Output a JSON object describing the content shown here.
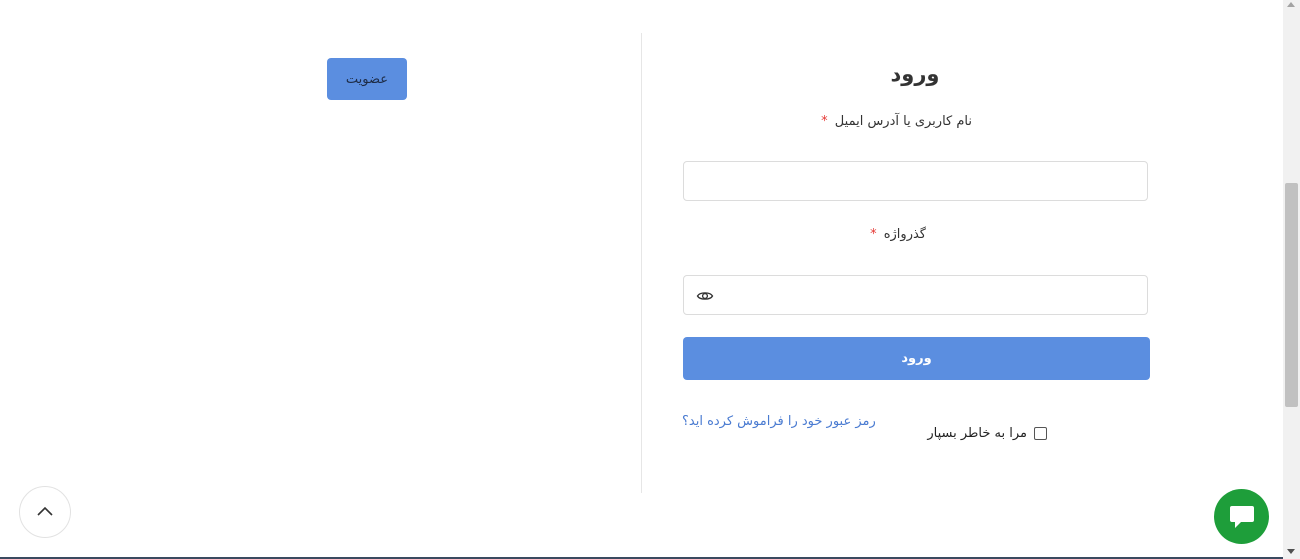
{
  "register": {
    "label": "عضویت"
  },
  "login": {
    "title": "ورود",
    "username_label": "نام کاربری یا آدرس ایمیل",
    "password_label": "گذرواژه",
    "required_mark": "*",
    "username_value": "",
    "password_value": "",
    "submit_label": "ورود",
    "remember_label": "مرا به خاطر بسپار",
    "remember_checked": false,
    "forgot_link": "رمز عبور خود را فراموش کرده اید؟"
  },
  "icons": {
    "password_toggle": "eye-icon",
    "scroll_top": "chevron-up-icon",
    "chat": "chat-icon"
  },
  "colors": {
    "accent": "#5b8ee0",
    "link": "#4a7bd1",
    "required": "#e53935",
    "chat": "#1e9e3a"
  }
}
